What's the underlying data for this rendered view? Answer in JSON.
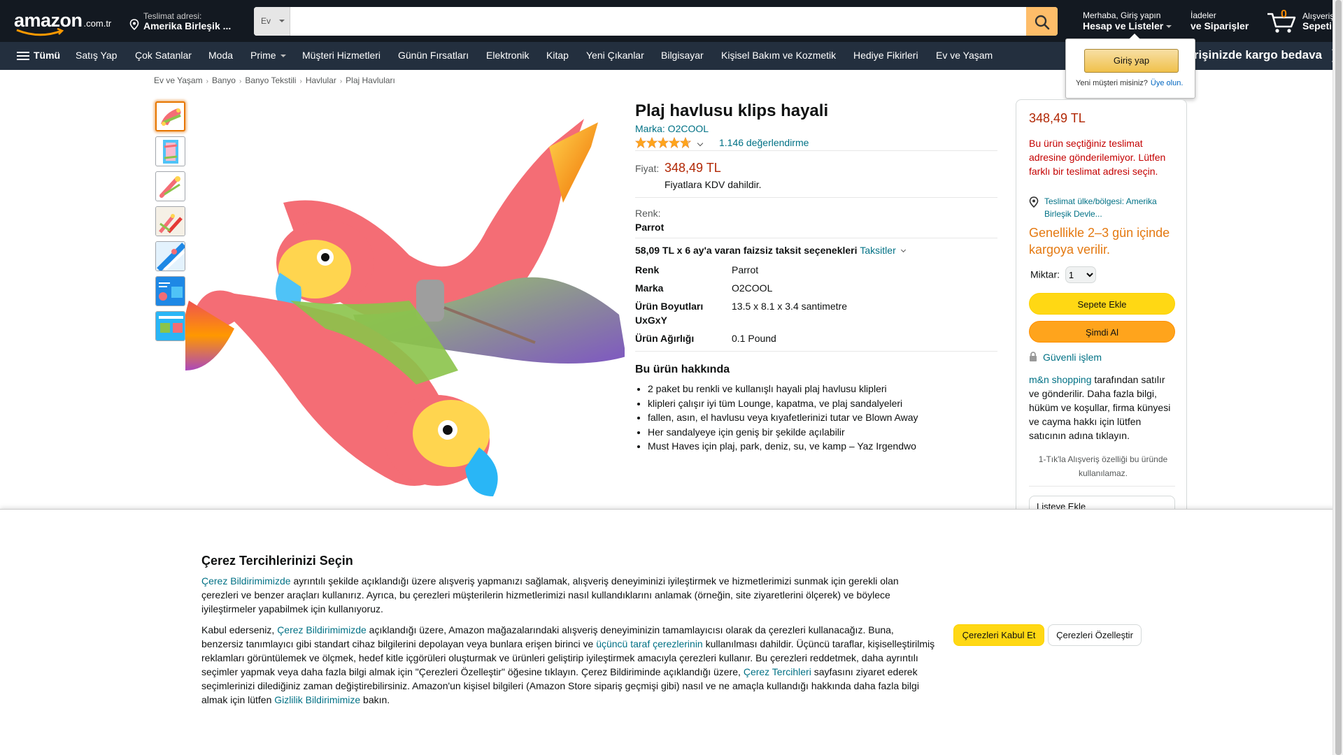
{
  "header": {
    "logo_text": "amazon",
    "logo_tld": ".com.tr",
    "deliver_line1": "Teslimat adresi:",
    "deliver_line2": "Amerika Birleşik ...",
    "search_category": "Ev",
    "search_placeholder": "",
    "account_line1": "Merhaba, Giriş yapın",
    "account_line2": "Hesap ve Listeler",
    "orders_line1": "İadeler",
    "orders_line2": "ve Siparişler",
    "cart_count": "0",
    "cart_line1": "Alışveriş",
    "cart_line2": "Sepeti"
  },
  "signin_flyout": {
    "button": "Giriş yap",
    "new_customer": "Yeni müşteri misiniz?",
    "register": "Üye olun."
  },
  "nav": {
    "all": "Tümü",
    "items": [
      "Satış Yap",
      "Çok Satanlar",
      "Moda",
      "Prime",
      "Müşteri Hizmetleri",
      "Günün Fırsatları",
      "Elektronik",
      "Kitap",
      "Yeni Çıkanlar",
      "Bilgisayar",
      "Kişisel Bakım ve Kozmetik",
      "Hediye Fikirleri",
      "Ev ve Yaşam"
    ],
    "promo": "irişinizde kargo bedava"
  },
  "breadcrumb": [
    "Ev ve Yaşam",
    "Banyo",
    "Banyo Tekstili",
    "Havlular",
    "Plaj Havluları"
  ],
  "product": {
    "title": "Plaj havlusu klips hayali",
    "brand_link": "Marka: O2COOL",
    "rating": 4.7,
    "rating_count": "1.146 değerlendirme",
    "price_label": "Fiyat:",
    "price": "348,49 TL",
    "vat_note": "Fiyatlara KDV dahildir.",
    "color_label": "Renk:",
    "color_value": "Parrot",
    "installment_text": "58,09 TL x 6 ay'a varan faizsiz taksit seçenekleri",
    "installment_link": "Taksitler",
    "specs": [
      {
        "key": "Renk",
        "value": "Parrot"
      },
      {
        "key": "Marka",
        "value": "O2COOL"
      },
      {
        "key": "Ürün Boyutları UxGxY",
        "value": "13.5 x 8.1 x 3.4 santimetre"
      },
      {
        "key": "Ürün Ağırlığı",
        "value": "0.1 Pound"
      }
    ],
    "about_title": "Bu ürün hakkında",
    "about": [
      "2 paket bu renkli ve kullanışlı hayali plaj havlusu klipleri",
      "klipleri çalışır iyi tüm Lounge, kapatma, ve plaj sandalyeleri",
      "fallen, asın, el havlusu veya kıyafetlerinizi tutar ve Blown Away",
      "Her sandalyeye için geniş bir şekilde açılabilir",
      "Must Haves için plaj, park, deniz, su, ve kamp – Yaz Irgendwo"
    ]
  },
  "buybox": {
    "price": "348,49 TL",
    "warning": "Bu ürün seçtiğiniz teslimat adresine gönderilemiyor. Lütfen farklı bir teslimat adresi seçin.",
    "location_link": "Teslimat ülke/bölgesi: Amerika Birleşik Devle...",
    "shipping": "Genellikle 2–3 gün içinde kargoya verilir.",
    "qty_label": "Miktar:",
    "qty_value": "1",
    "add_to_cart": "Sepete Ekle",
    "buy_now": "Şimdi Al",
    "secure": "Güvenli işlem",
    "seller_link": "m&n shopping",
    "seller_text": " tarafından satılır ve gönderilir. Daha fazla bilgi, hüküm ve koşullar, firma künyesi ve cayma hakkı için lütfen satıcının adına tıklayın.",
    "oneclick": "1-Tık'la Alışveriş özelliği bu üründe kullanılamaz.",
    "add_to_list": "Listeye Ekle"
  },
  "cookie": {
    "title": "Çerez Tercihlerinizi Seçin",
    "p1_link": "Çerez Bildirimimizde",
    "p1_text": " ayrıntılı şekilde açıklandığı üzere alışveriş yapmanızı sağlamak, alışveriş deneyiminizi iyileştirmek ve hizmetlerimizi sunmak için gerekli olan çerezleri ve benzer araçları kullanırız. Ayrıca, bu çerezleri müşterilerin hizmetlerimizi nasıl kullandıklarını anlamak (örneğin, site ziyaretlerini ölçerek) ve böylece iyileştirmeler yapabilmek için kullanıyoruz.",
    "p2_a": "Kabul ederseniz, ",
    "p2_link1": "Çerez Bildirimimizde",
    "p2_b": " açıklandığı üzere, Amazon mağazalarındaki alışveriş deneyiminizin tamamlayıcısı olarak da çerezleri kullanacağız. Buna, benzersiz tanımlayıcı gibi standart cihaz bilgilerini depolayan veya bunlara erişen birinci ve ",
    "p2_link2": "üçüncü taraf çerezlerinin",
    "p2_c": " kullanılması dahildir. Üçüncü taraflar, kişiselleştirilmiş reklamları görüntülemek ve ölçmek, hedef kitle içgörüleri oluşturmak ve ürünleri geliştirip iyileştirmek amacıyla çerezleri kullanır. Bu çerezleri reddetmek, daha ayrıntılı seçimler yapmak veya daha fazla bilgi almak için \"Çerezleri Özelleştir\" öğesine tıklayın. Çerez Bildiriminde açıklandığı üzere, ",
    "p2_link3": "Çerez Tercihleri",
    "p2_d": " sayfasını ziyaret ederek seçimlerinizi dilediğiniz zaman değiştirebilirsiniz. Amazon'un kişisel bilgileri (Amazon Store sipariş geçmişi gibi) nasıl ve ne amaçla kullandığı hakkında daha fazla bilgi almak için lütfen ",
    "p2_link4": "Gizlilik Bildirimimize",
    "p2_e": " bakın.",
    "accept": "Çerezleri Kabul Et",
    "customize": "Çerezleri Özelleştir"
  },
  "colors": {
    "nav_dark": "#131921",
    "nav_sub": "#232f3e",
    "price": "#B12704",
    "link": "#007185",
    "cart_yellow": "#FFD814",
    "buy_orange": "#FFA41C",
    "star": "#FFA41C"
  }
}
